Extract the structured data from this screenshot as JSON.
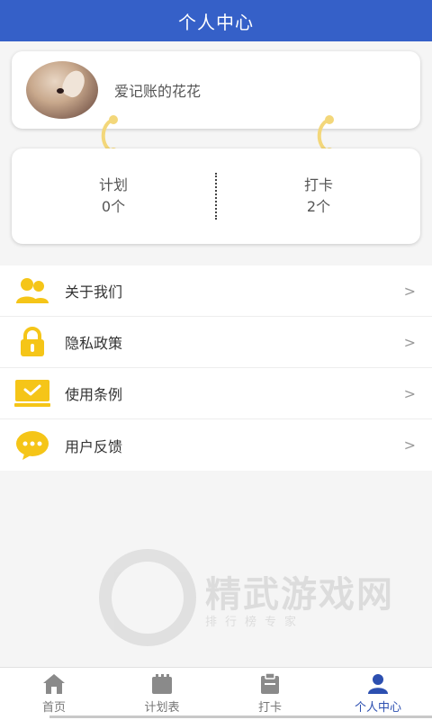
{
  "header": {
    "title": "个人中心"
  },
  "profile": {
    "username": "爱记账的花花"
  },
  "stats": [
    {
      "label": "计划",
      "value": "0个"
    },
    {
      "label": "打卡",
      "value": "2个"
    }
  ],
  "menu": [
    {
      "label": "关于我们",
      "icon": "users-icon"
    },
    {
      "label": "隐私政策",
      "icon": "lock-icon"
    },
    {
      "label": "使用条例",
      "icon": "laptop-check-icon"
    },
    {
      "label": "用户反馈",
      "icon": "chat-bubble-icon"
    }
  ],
  "watermark": {
    "title": "精武游戏网",
    "subtitle": "排行榜专家"
  },
  "tabs": [
    {
      "label": "首页",
      "icon": "home-icon"
    },
    {
      "label": "计划表",
      "icon": "calendar-icon"
    },
    {
      "label": "打卡",
      "icon": "clipboard-icon"
    },
    {
      "label": "个人中心",
      "icon": "person-icon",
      "active": true
    }
  ],
  "colors": {
    "header_bg": "#3560c8",
    "icon_yellow": "#f5c518",
    "active_tab": "#2c4fb0"
  }
}
